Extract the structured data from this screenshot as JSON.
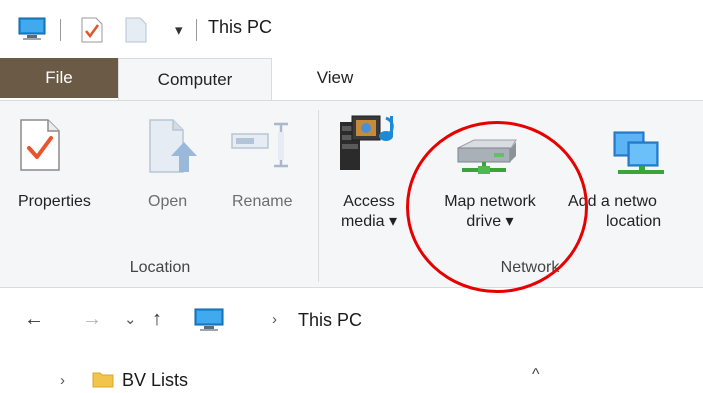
{
  "window": {
    "title": "This PC"
  },
  "quick_access": {
    "dropdown_glyph": "▾"
  },
  "tabs": [
    {
      "label": "File"
    },
    {
      "label": "Computer"
    },
    {
      "label": "View"
    }
  ],
  "ribbon": {
    "location_group": {
      "label": "Location",
      "buttons": [
        {
          "label": "Properties"
        },
        {
          "label": "Open"
        },
        {
          "label": "Rename"
        }
      ]
    },
    "network_group": {
      "label": "Network",
      "buttons": [
        {
          "label_line1": "Access",
          "label_line2": "media ▾"
        },
        {
          "label_line1": "Map network",
          "label_line2": "drive ▾"
        },
        {
          "label_line1": "Add a netwo",
          "label_line2": "location"
        }
      ]
    }
  },
  "address_bar": {
    "back_glyph": "←",
    "forward_glyph": "→",
    "recent_glyph": "⌄",
    "up_glyph": "↑",
    "separator": "›",
    "crumb": "This PC"
  },
  "nav_pane": {
    "item_label": "BV Lists",
    "expand_glyph": "›",
    "scroll_up_glyph": "^"
  },
  "annotation": {
    "color": "#e60000"
  }
}
